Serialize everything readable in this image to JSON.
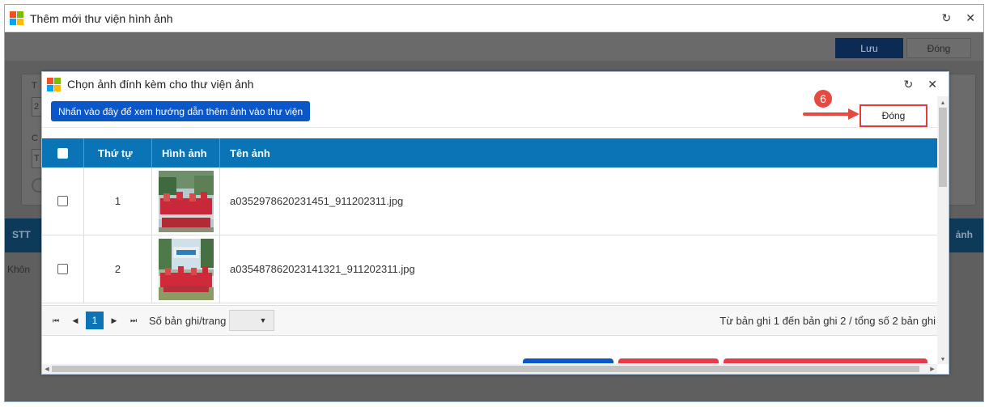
{
  "outer_window": {
    "title": "Thêm mới thư viện hình ảnh",
    "refresh_icon": "↻",
    "close_icon": "✕",
    "toolbar": {
      "save_label": "Lưu",
      "close_label": "Đóng"
    },
    "fragments": {
      "label_1": "T",
      "value_1": "2",
      "label_2": "C",
      "value_2": "T",
      "table_stt": "STT",
      "table_anh": "ảnh",
      "empty_text": "Khôn"
    }
  },
  "modal": {
    "title": "Chọn ảnh đính kèm cho thư viện ảnh",
    "refresh_icon": "↻",
    "close_icon": "✕",
    "guide_button": "Nhấn vào đây để xem hướng dẫn thêm ảnh vào thư viện",
    "close_button": "Đóng",
    "step_badge": "6",
    "table": {
      "headers": {
        "order": "Thứ tự",
        "image": "Hình ảnh",
        "name": "Tên ảnh"
      },
      "rows": [
        {
          "order": "1",
          "name": "a0352978620231451_911202311.jpg",
          "thumbnail": "group-photo-fence"
        },
        {
          "order": "2",
          "name": "a035487862023141321_911202311.jpg",
          "thumbnail": "group-photo-banner"
        }
      ]
    },
    "pager": {
      "first_icon": "⏮",
      "prev_icon": "◀",
      "current_page": "1",
      "next_icon": "▶",
      "last_icon": "⏭",
      "page_size_label": "Số bản ghi/trang",
      "page_size_value": "",
      "summary": "Từ bản ghi 1 đến bản ghi 2 / tổng số 2 bản ghi"
    }
  },
  "colors": {
    "header_blue": "#0a74b6",
    "guide_button": "#0b57c8",
    "highlight_red": "#e63b3b",
    "annotation_red": "#e6493f"
  }
}
